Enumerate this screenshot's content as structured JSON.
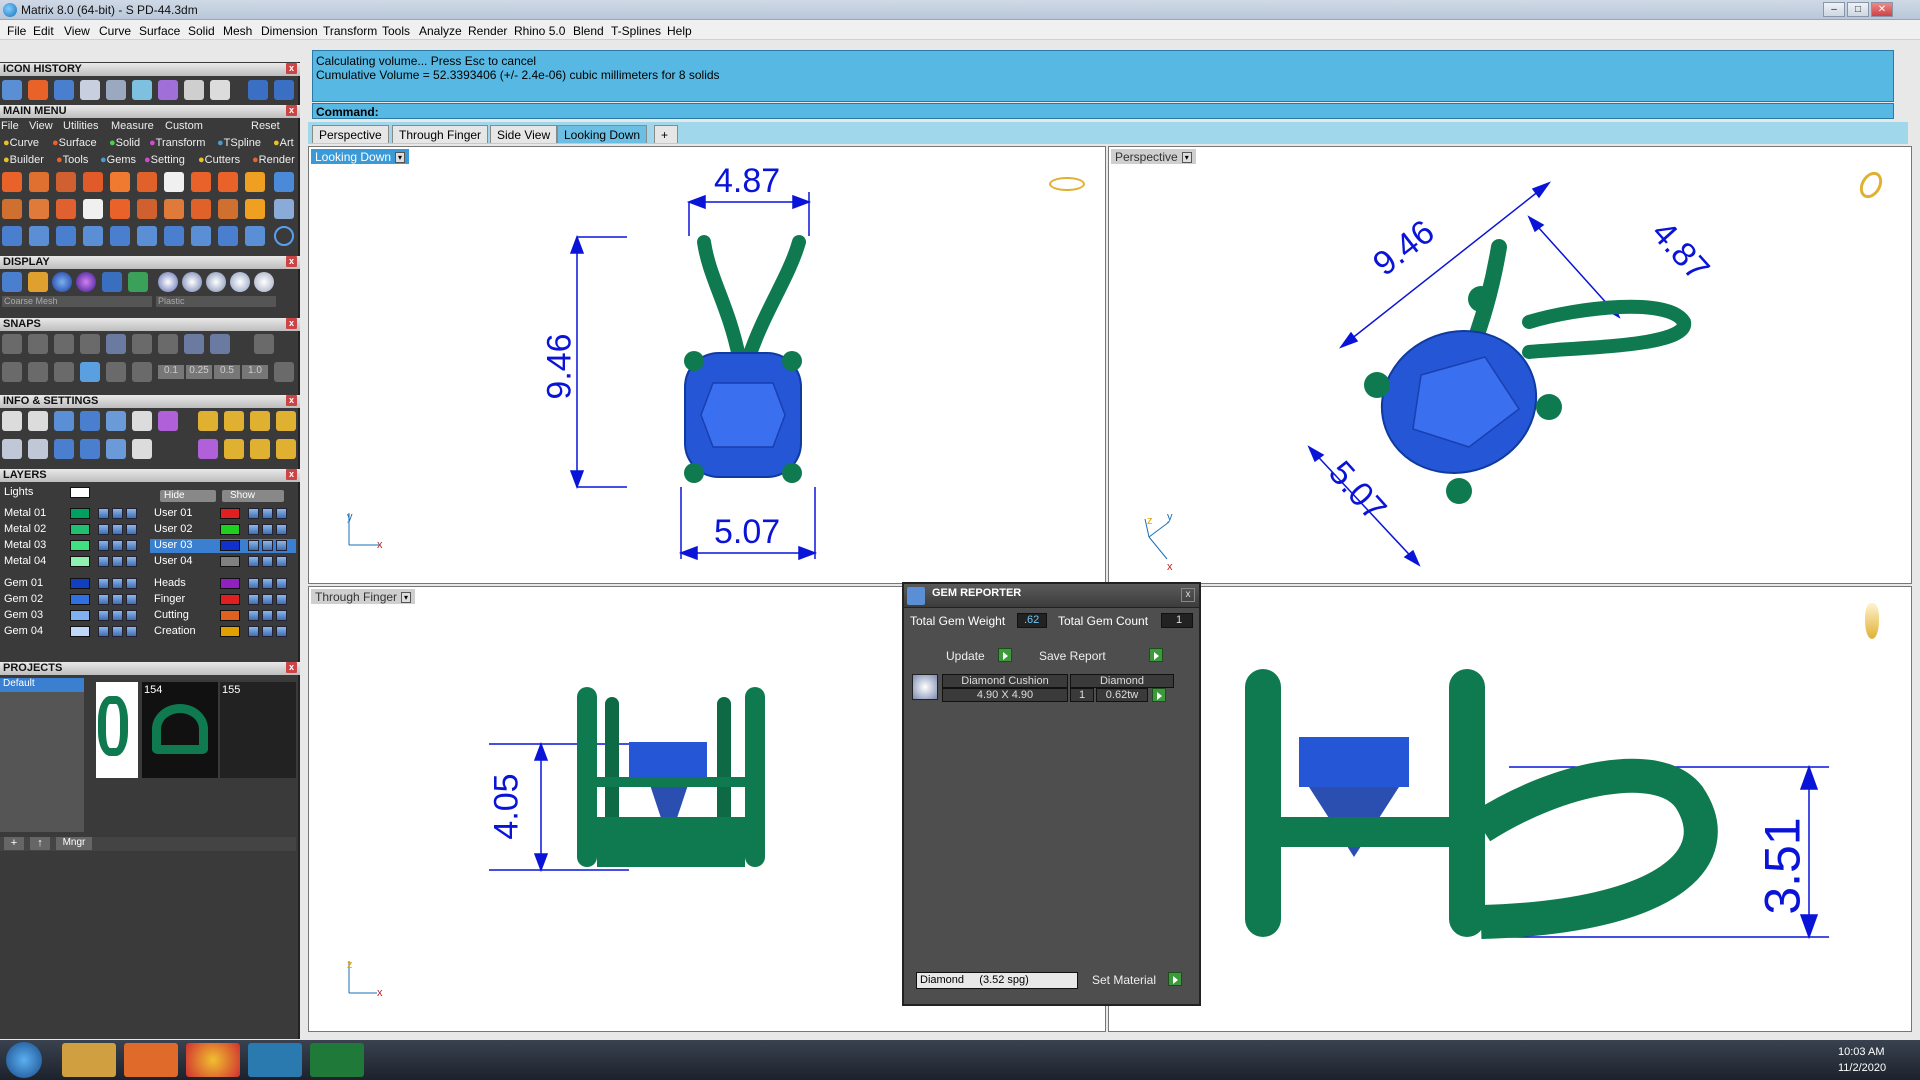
{
  "window": {
    "title": "Matrix 8.0 (64-bit) - S PD-44.3dm"
  },
  "menubar": [
    "File",
    "Edit",
    "View",
    "Curve",
    "Surface",
    "Solid",
    "Mesh",
    "Dimension",
    "Transform",
    "Tools",
    "Analyze",
    "Render",
    "Rhino 5.0",
    "Blend",
    "T-Splines",
    "Help"
  ],
  "panels": {
    "icon_history": "ICON HISTORY",
    "main_menu": "MAIN MENU",
    "main_menu_items": [
      "File",
      "View",
      "Utilities",
      "Measure",
      "Custom",
      "Reset"
    ],
    "main_menu_row2": [
      "Curve",
      "Surface",
      "Solid",
      "Transform",
      "TSpline",
      "Art"
    ],
    "main_menu_row3": [
      "Builder",
      "Tools",
      "Gems",
      "Setting",
      "Cutters",
      "Render"
    ],
    "display": "DISPLAY",
    "display_mesh": "Coarse Mesh",
    "display_material": "Plastic",
    "snaps": "SNAPS",
    "snap_values": [
      "0.1",
      "0.25",
      "0.5",
      "1.0"
    ],
    "info_settings": "INFO & SETTINGS",
    "layers": "LAYERS",
    "layers_hide": "Hide",
    "layers_show": "Show",
    "layers_lights": "Lights",
    "layers_left": [
      {
        "name": "Metal 01",
        "color": "#00a060"
      },
      {
        "name": "Metal 02",
        "color": "#20c070"
      },
      {
        "name": "Metal 03",
        "color": "#40e080"
      },
      {
        "name": "Metal 04",
        "color": "#90f0b0"
      },
      {
        "name": "Gem 01",
        "color": "#1040c0"
      },
      {
        "name": "Gem 02",
        "color": "#3070e0"
      },
      {
        "name": "Gem 03",
        "color": "#80b0f0"
      },
      {
        "name": "Gem 04",
        "color": "#c0d8f8"
      }
    ],
    "layers_right": [
      {
        "name": "User 01",
        "color": "#e02020"
      },
      {
        "name": "User 02",
        "color": "#20d020"
      },
      {
        "name": "User 03",
        "color": "#1030d0"
      },
      {
        "name": "User 04",
        "color": "#808080"
      },
      {
        "name": "Heads",
        "color": "#9020c0"
      },
      {
        "name": "Finger",
        "color": "#e02020"
      },
      {
        "name": "Cutting",
        "color": "#e06020"
      },
      {
        "name": "Creation",
        "color": "#e0a000"
      }
    ],
    "projects": "PROJECTS",
    "project_default": "Default",
    "project_thumbs": [
      "154",
      "155"
    ],
    "project_mngr": "Mngr"
  },
  "command": {
    "line1": "Calculating volume... Press Esc to cancel",
    "line2": "Cumulative Volume = 52.3393406 (+/- 2.4e-06) cubic millimeters for 8 solids",
    "prompt": "Command:"
  },
  "view_tabs": [
    "Perspective",
    "Through Finger",
    "Side View",
    "Looking Down"
  ],
  "active_tab": "Looking Down",
  "viewports": {
    "top_left": {
      "label": "Looking Down",
      "dims": {
        "width": "4.87",
        "height": "9.46",
        "bottom": "5.07"
      },
      "axis_y": "y",
      "axis_x": "x"
    },
    "top_right": {
      "label": "Perspective",
      "dims": {
        "a": "9.46",
        "b": "4.87",
        "c": "5.07"
      },
      "axis_y": "y",
      "axis_z": "z",
      "axis_x": "x"
    },
    "bottom_left": {
      "label": "Through Finger",
      "dims": {
        "height": "4.05"
      },
      "axis_z": "z",
      "axis_x": "x"
    },
    "bottom_right": {
      "dims": {
        "height": "3.51"
      }
    }
  },
  "gem_reporter": {
    "title": "GEM REPORTER",
    "total_weight_label": "Total Gem Weight",
    "total_weight": ".62",
    "total_count_label": "Total Gem Count",
    "total_count": "1",
    "update": "Update",
    "save_report": "Save Report",
    "gem_name": "Diamond Cushion",
    "gem_size": "4.90 X 4.90",
    "gem_material": "Diamond",
    "gem_qty": "1",
    "gem_weight": "0.62tw",
    "material_select": "Diamond     (3.52 spg)",
    "set_material": "Set Material"
  },
  "taskbar": {
    "time": "10:03 AM",
    "date": "11/2/2020"
  },
  "colors": {
    "metal": "#0f7a4f",
    "gem": "#2456d6",
    "dimension": "#0a14d8",
    "cmd_bg": "#57b9e3"
  }
}
